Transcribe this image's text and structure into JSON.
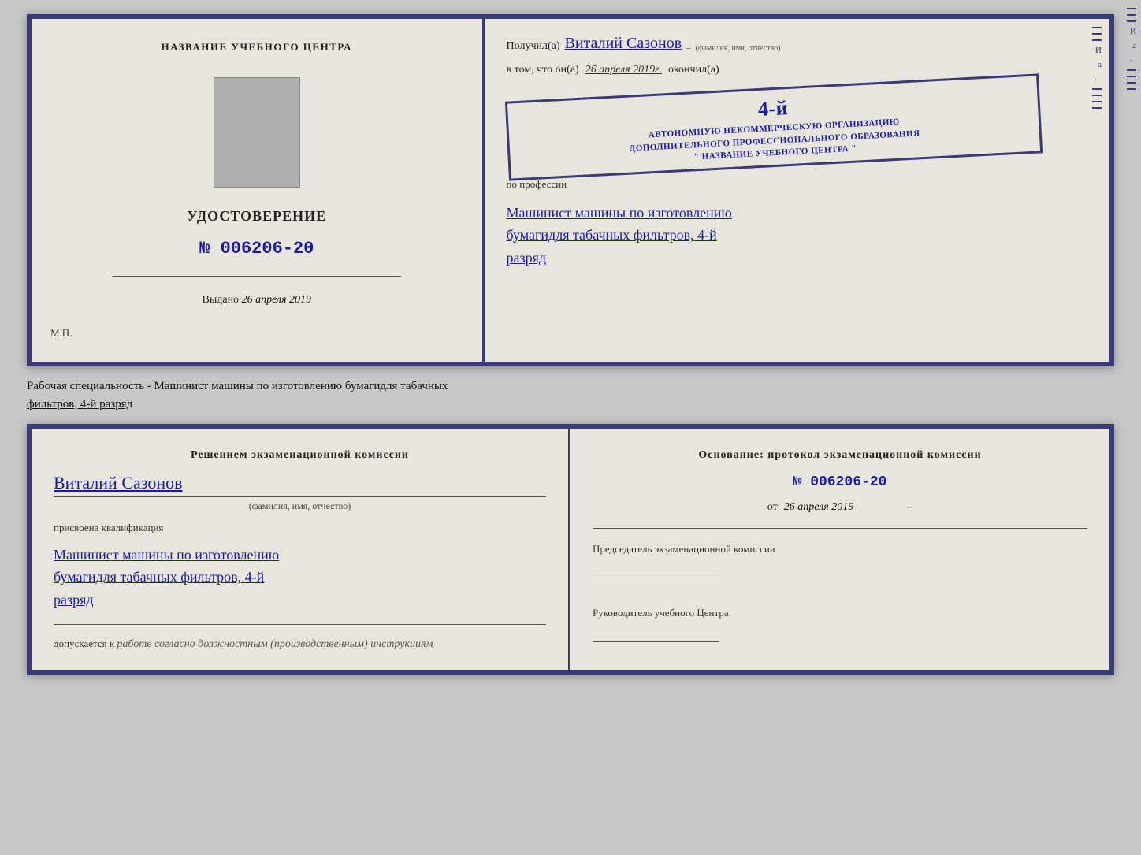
{
  "diploma": {
    "left": {
      "institution_label": "НАЗВАНИЕ УЧЕБНОГО ЦЕНТРА",
      "cert_title": "УДОСТОВЕРЕНИЕ",
      "cert_number_prefix": "№",
      "cert_number": "006206-20",
      "issued_label": "Выдано",
      "issued_date": "26 апреля 2019",
      "mp_label": "М.П."
    },
    "right": {
      "recipient_prefix": "Получил(а)",
      "recipient_name": "Виталий Сазонов",
      "recipient_subtext": "(фамилия, имя, отчество)",
      "date_prefix": "в том, что он(а)",
      "date_value": "26 апреля 2019г.",
      "date_suffix": "окончил(а)",
      "stamp_num": "4-й",
      "stamp_line1": "АВТОНОМНУЮ НЕКОММЕРЧЕСКУЮ ОРГАНИЗАЦИЮ",
      "stamp_line2": "ДОПОЛНИТЕЛЬНОГО ПРОФЕССИОНАЛЬНОГО ОБРАЗОВАНИЯ",
      "stamp_line3": "\" НАЗВАНИЕ УЧЕБНОГО ЦЕНТРА \"",
      "profession_prefix": "по профессии",
      "profession_line1": "Машинист машины по изготовлению",
      "profession_line2": "бумагидля табачных фильтров, 4-й",
      "profession_line3": "разряд"
    }
  },
  "middle_label": {
    "text": "Рабочая специальность - Машинист машины по изготовлению бумагидля табачных",
    "text2": "фильтров, 4-й разряд"
  },
  "back": {
    "left": {
      "title": "Решением экзаменационной комиссии",
      "name": "Виталий Сазонов",
      "name_subtext": "(фамилия, имя, отчество)",
      "qualification_label": "присвоена квалификация",
      "qual_line1": "Машинист машины по изготовлению",
      "qual_line2": "бумагидля табачных фильтров, 4-й",
      "qual_line3": "разряд",
      "allow_prefix": "допускается к",
      "allow_text": "работе согласно должностным (производственным) инструкциям"
    },
    "right": {
      "basis_label": "Основание: протокол экзаменационной комиссии",
      "number_prefix": "№",
      "number_value": "006206-20",
      "date_prefix": "от",
      "date_value": "26 апреля 2019",
      "chairman_label": "Председатель экзаменационной комиссии",
      "director_label": "Руководитель учебного Центра"
    }
  }
}
